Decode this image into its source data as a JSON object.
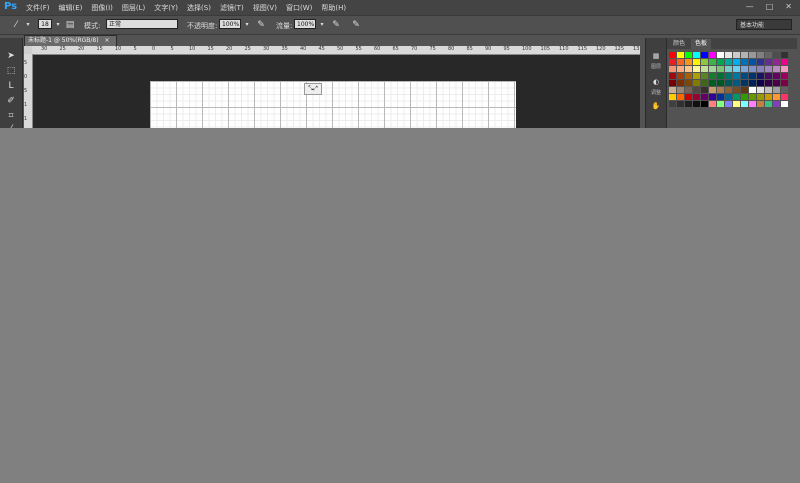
{
  "app": {
    "logo": "Ps"
  },
  "menu": [
    "文件(F)",
    "编辑(E)",
    "图像(I)",
    "图层(L)",
    "文字(Y)",
    "选择(S)",
    "滤镜(T)",
    "视图(V)",
    "窗口(W)",
    "帮助(H)"
  ],
  "window_controls": [
    "—",
    "□",
    "✕"
  ],
  "options": {
    "brush_size": "18",
    "mode_label": "模式:",
    "mode_value": "正常",
    "opacity_label": "不透明度:",
    "opacity_value": "100%",
    "flow_label": "流量:",
    "flow_value": "100%",
    "workspace": "基本功能"
  },
  "document": {
    "tab_title": "未标题-1 @ 50%(RGB/8)",
    "close": "×"
  },
  "ruler_h": [
    "30",
    "25",
    "20",
    "15",
    "10",
    "5",
    "0",
    "5",
    "10",
    "15",
    "20",
    "25",
    "30",
    "35",
    "40",
    "45",
    "50",
    "55",
    "60",
    "65",
    "70",
    "75",
    "80",
    "85",
    "90",
    "95",
    "100",
    "105",
    "110",
    "115",
    "120",
    "125",
    "13"
  ],
  "ruler_v": [
    "5",
    "0",
    "5",
    "1",
    "1"
  ],
  "selection_marker": "⤡⤢",
  "panels": {
    "tabs": [
      "颜色",
      "色板"
    ],
    "active_tab": 1,
    "side_labels": [
      "图层",
      "调整"
    ],
    "swatch_rows": [
      [
        "#ff0000",
        "#ffff00",
        "#00ff00",
        "#00ffff",
        "#0000ff",
        "#ff00ff",
        "#ffffff",
        "#e6e6e6",
        "#cccccc",
        "#b3b3b3",
        "#999999",
        "#808080",
        "#666666",
        "#4d4d4d",
        "#333333"
      ],
      [
        "#ed1c24",
        "#f26522",
        "#f7941d",
        "#fff200",
        "#8dc63f",
        "#39b54a",
        "#00a651",
        "#00a99d",
        "#00aeef",
        "#0072bc",
        "#0054a6",
        "#2e3192",
        "#662d91",
        "#92278f",
        "#ec008c"
      ],
      [
        "#f69679",
        "#f9ad81",
        "#fdc68a",
        "#fff799",
        "#c4df9b",
        "#a3d39c",
        "#7cc576",
        "#7accc8",
        "#6dcff6",
        "#7da7d9",
        "#8393ca",
        "#8781bd",
        "#a186be",
        "#bd8cbf",
        "#f49ac1"
      ],
      [
        "#9e0b0f",
        "#a0410d",
        "#a36209",
        "#aba000",
        "#598527",
        "#1a7b30",
        "#007236",
        "#00746b",
        "#0076a3",
        "#004a80",
        "#003471",
        "#1b1464",
        "#440e62",
        "#630460",
        "#9e005d"
      ],
      [
        "#790000",
        "#7b2e00",
        "#7d4900",
        "#827b00",
        "#406618",
        "#005e20",
        "#005826",
        "#005952",
        "#005b7f",
        "#003663",
        "#002157",
        "#0d004c",
        "#32004b",
        "#4b0049",
        "#7b0046"
      ],
      [
        "#c7b299",
        "#998675",
        "#736357",
        "#534741",
        "#37302d",
        "#c69c6d",
        "#a67c52",
        "#8c6239",
        "#754c24",
        "#603913",
        "#ffffff",
        "#e0e0e0",
        "#c0c0c0",
        "#a0a0a0",
        "#606060"
      ],
      [
        "#ffcc00",
        "#ff6600",
        "#cc0000",
        "#990033",
        "#660066",
        "#330099",
        "#003399",
        "#006699",
        "#009966",
        "#339900",
        "#669900",
        "#999900",
        "#cc9900",
        "#ff9933",
        "#ff3366"
      ],
      [
        "#404040",
        "#303030",
        "#202020",
        "#101010",
        "#000000",
        "#ff8080",
        "#80ff80",
        "#8080ff",
        "#ffff80",
        "#80ffff",
        "#ff80ff",
        "#c08040",
        "#40c080",
        "#8040c0",
        "#ffffff"
      ]
    ]
  }
}
